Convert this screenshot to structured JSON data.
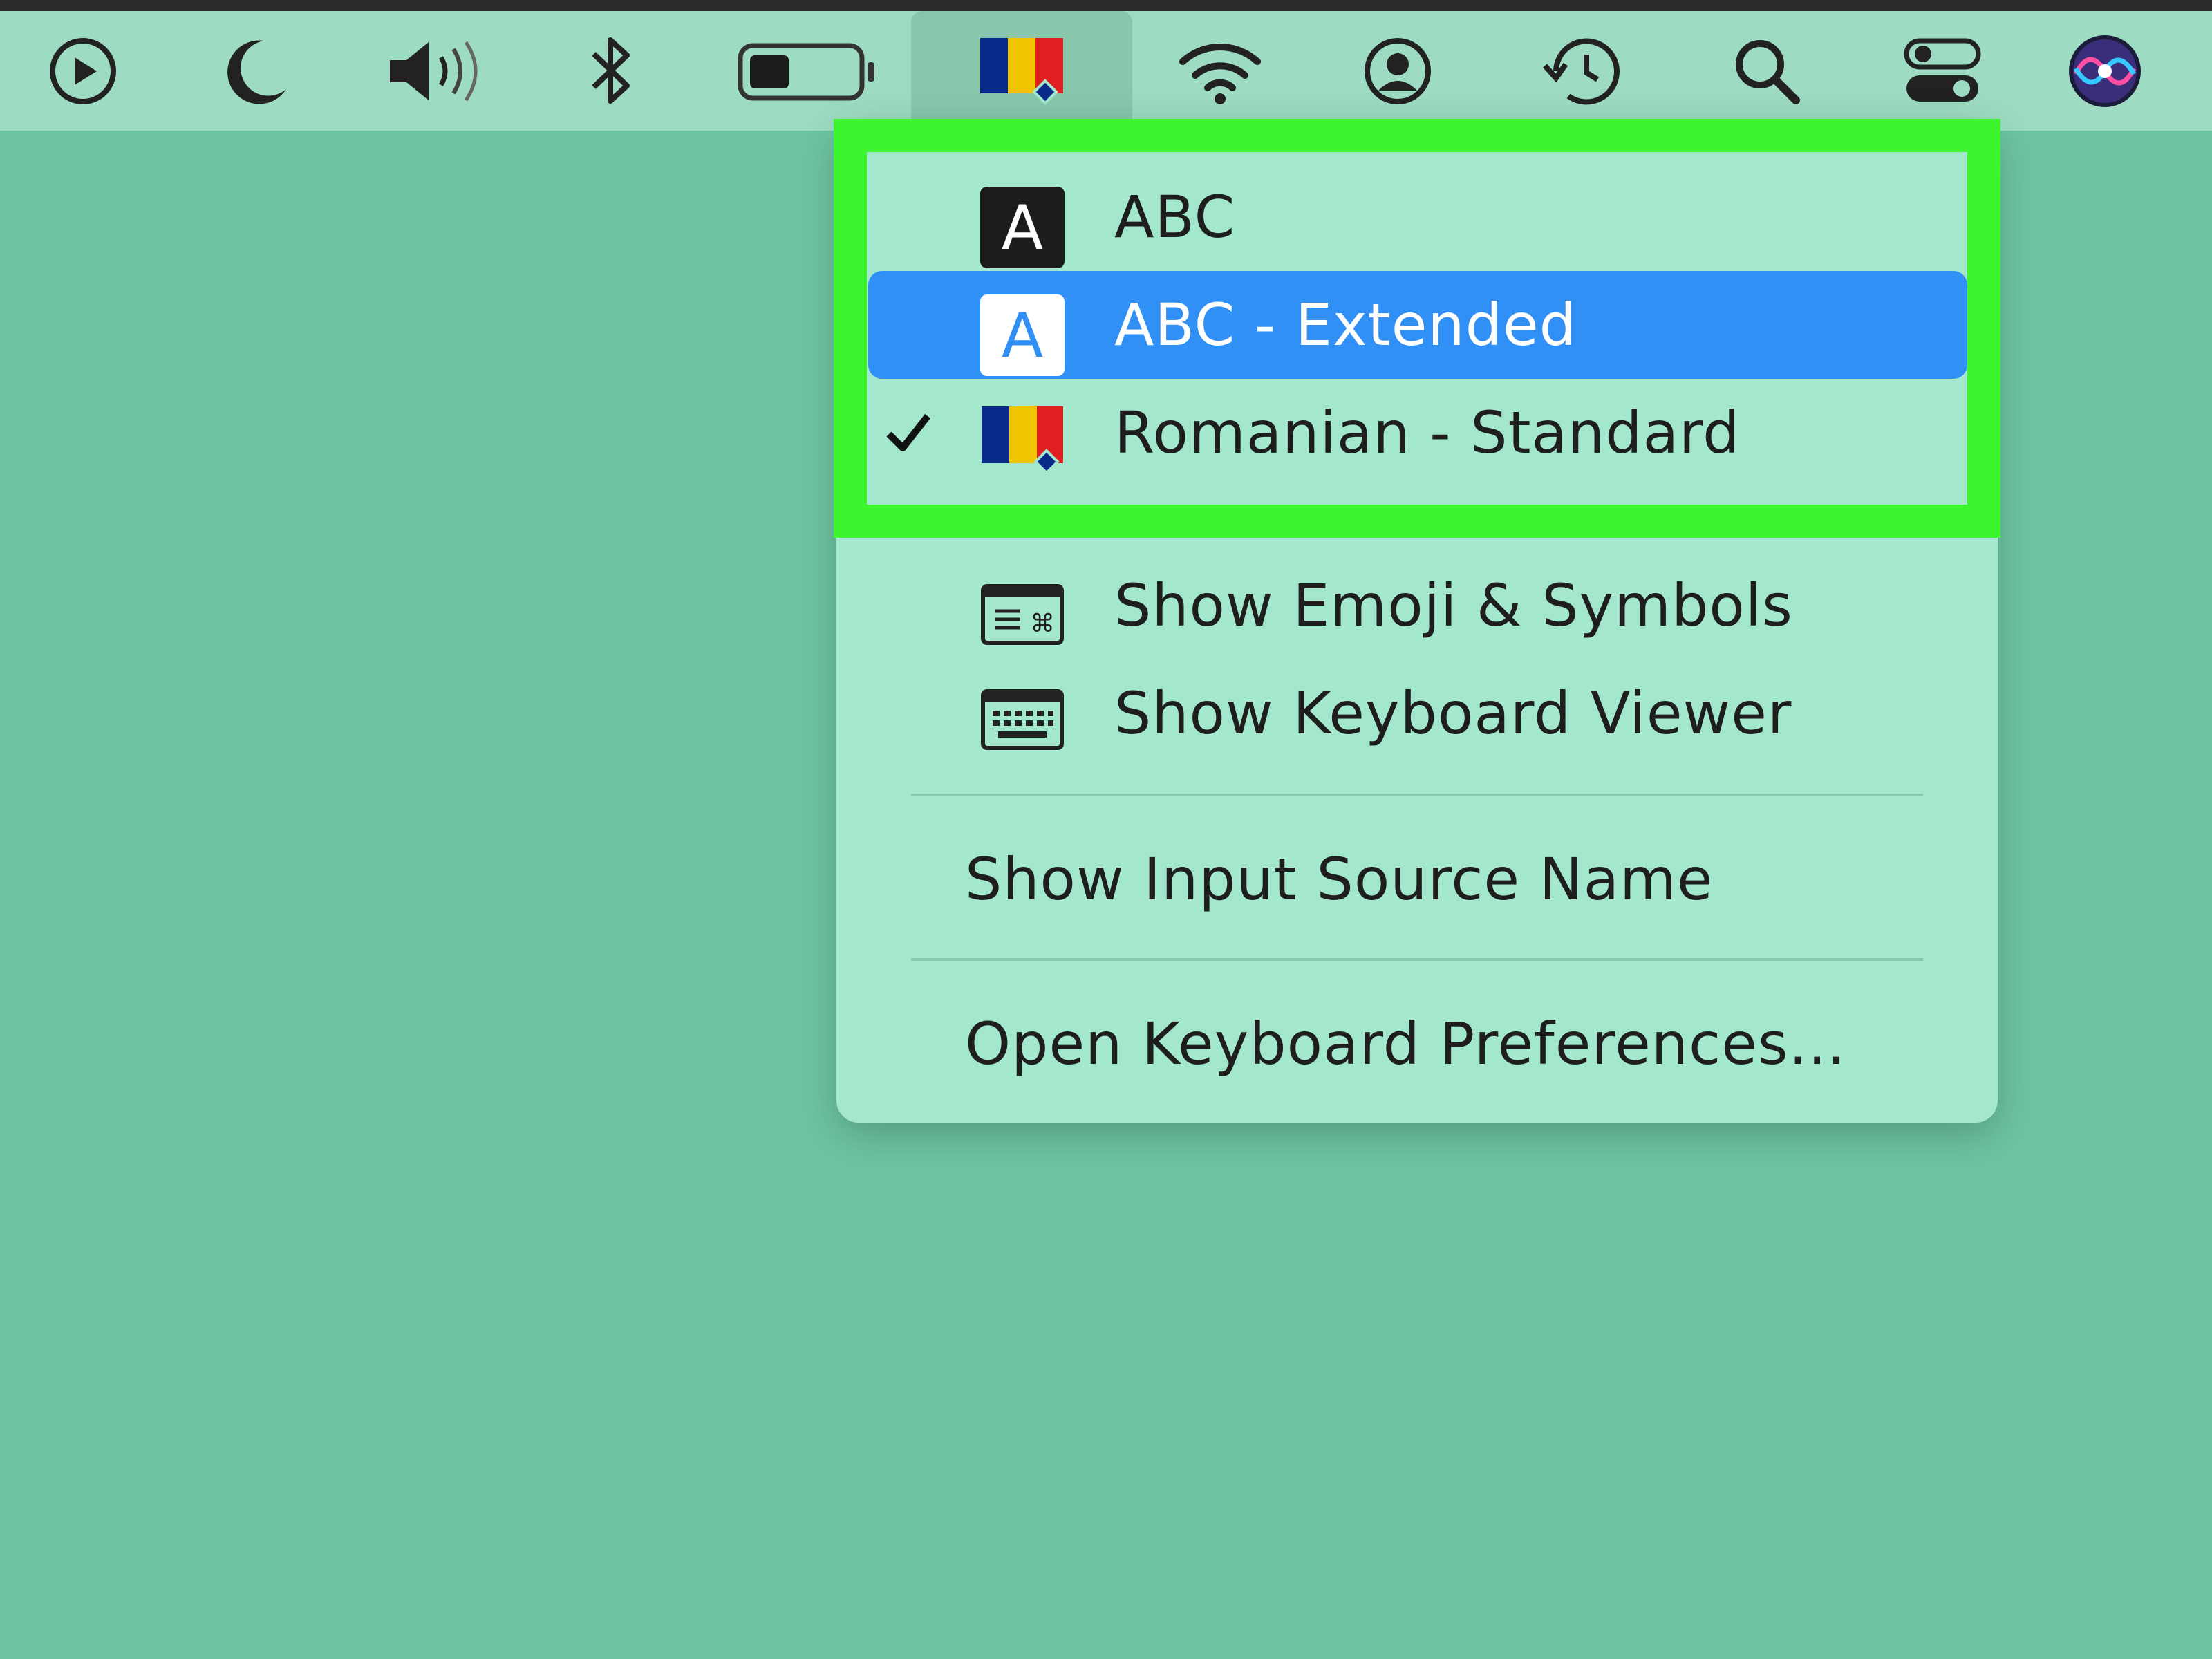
{
  "menubar": {
    "icons": [
      "play-circle-icon",
      "moon-icon",
      "volume-icon",
      "bluetooth-icon",
      "battery-icon",
      "romanian-flag-icon",
      "wifi-icon",
      "user-icon",
      "time-machine-icon",
      "search-icon",
      "control-center-icon",
      "siri-icon"
    ]
  },
  "input_menu": {
    "sources": [
      {
        "label": "ABC",
        "icon": "letter-a-dark-icon",
        "checked": false,
        "highlighted": false
      },
      {
        "label": "ABC - Extended",
        "icon": "letter-a-light-icon",
        "checked": false,
        "highlighted": true
      },
      {
        "label": "Romanian - Standard",
        "icon": "romanian-flag-icon",
        "checked": true,
        "highlighted": false
      }
    ],
    "tools": [
      {
        "label": "Show Emoji & Symbols",
        "icon": "emoji-symbols-icon"
      },
      {
        "label": "Show Keyboard Viewer",
        "icon": "keyboard-viewer-icon"
      }
    ],
    "show_source_name": "Show Input Source Name",
    "open_prefs": "Open Keyboard Preferences..."
  },
  "colors": {
    "background": "#6dc5a3",
    "menubar": "#9ddcc2",
    "menu": "#a3e8cd",
    "highlight": "#3190f5",
    "annotation_frame": "#3cf52e"
  }
}
